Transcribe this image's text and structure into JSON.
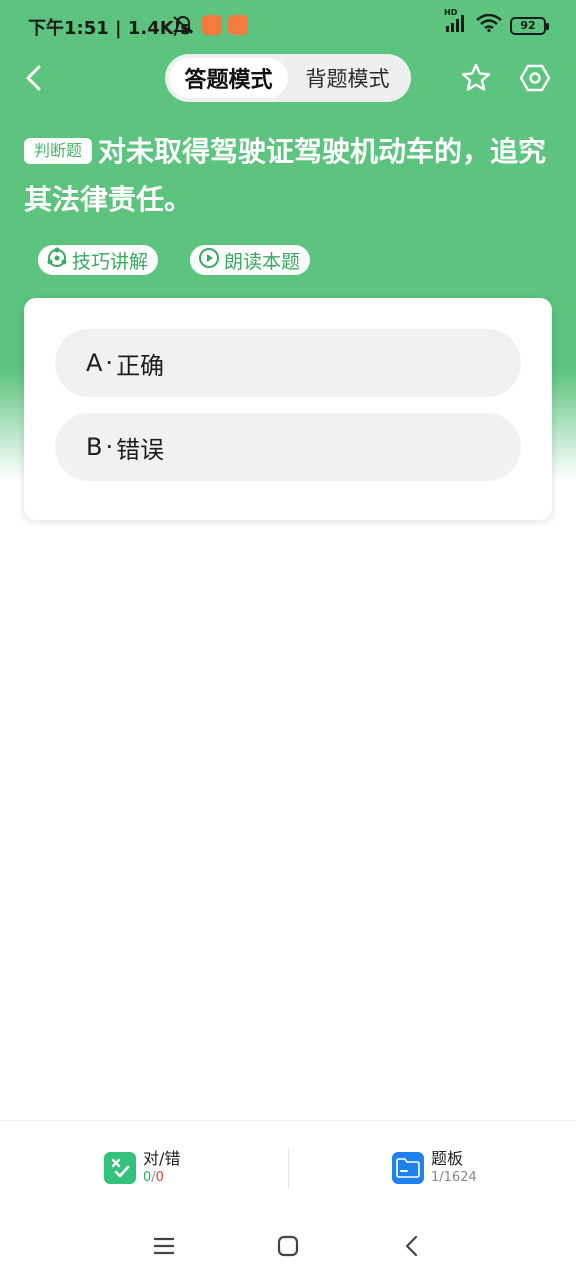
{
  "status_bar": {
    "time_speed": "下午1:51 | 1.4K/s",
    "network": "HD",
    "battery": "92"
  },
  "header": {
    "tabs": [
      "答题模式",
      "背题模式"
    ],
    "active_tab": "答题模式"
  },
  "question": {
    "type_label": "判断题",
    "text": "对未取得驾驶证驾驶机动车的，追究其法律责任。",
    "actions": [
      "技巧讲解",
      "朗读本题"
    ]
  },
  "options": [
    {
      "letter": "A",
      "text": "正确"
    },
    {
      "letter": "B",
      "text": "错误"
    }
  ],
  "bottom": {
    "score_title": "对/错",
    "correct": "0",
    "slash": "/",
    "wrong": "0",
    "board_title": "题板",
    "progress": "1/1624"
  },
  "colors": {
    "brand_green": "#5cc47f",
    "accent_green": "#3aaa61",
    "board_blue": "#1f80f0",
    "wrong_red": "#e03a3a"
  },
  "icons": [
    "back-arrow-icon",
    "star-icon",
    "settings-hexagon-icon",
    "skill-icon",
    "play-circle-icon",
    "check-cross-icon",
    "folder-icon",
    "menu-icon",
    "home-square-icon",
    "nav-back-icon"
  ]
}
